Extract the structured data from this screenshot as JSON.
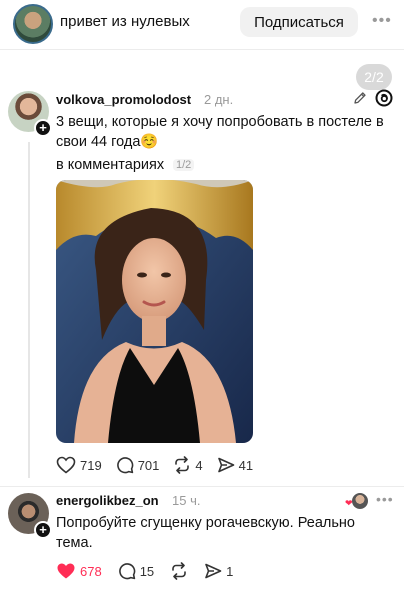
{
  "header": {
    "title": "привет из нулевых",
    "subscribe_label": "Подписаться",
    "more_icon": "more-horizontal-icon"
  },
  "page_badge": "2/2",
  "post": {
    "username": "volkova_promolodost",
    "time": "2 дн.",
    "text": "3 вещи, которые я хочу попробовать в постеле в свои 44 года☺️",
    "comments_link": "в комментариях",
    "comments_count": "1/2",
    "likes": "719",
    "replies": "701",
    "reposts": "4",
    "shares": "41",
    "icons": [
      "pencil-icon",
      "threads-icon"
    ]
  },
  "comment": {
    "username": "energolikbez_on",
    "time": "15 ч.",
    "text": "Попробуйте сгущенку рогачевскую. Реально тема.",
    "likes": "678",
    "replies": "15",
    "shares": "1",
    "like_color": "#ff2d55"
  },
  "colors": {
    "accent_like": "#ff2d55",
    "muted": "#9a9a9a",
    "subscribe_bg": "#f1f1f1"
  }
}
